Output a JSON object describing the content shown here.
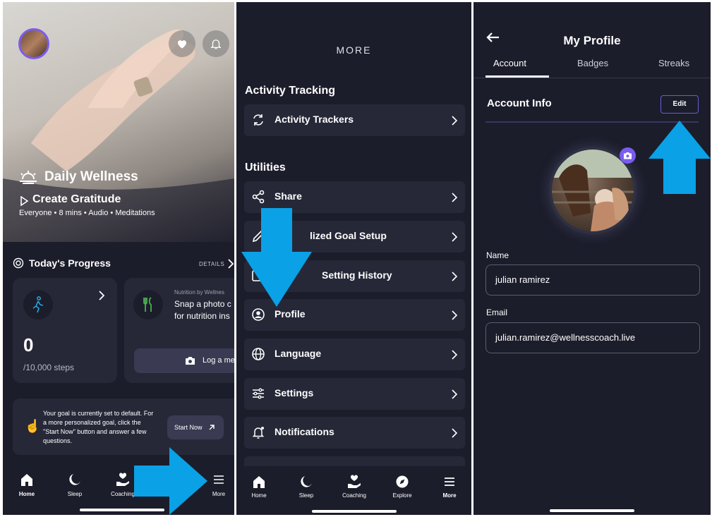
{
  "home": {
    "hero_title": "Daily Wellness",
    "hero_subtitle": "Create Gratitude",
    "hero_meta": [
      "Everyone",
      "8 mins",
      "Audio",
      "Meditations"
    ],
    "progress_title": "Today's Progress",
    "details_label": "DETAILS",
    "steps_value": "0",
    "steps_goal": "/10,000 steps",
    "nutrition_header": "Nutrition by Wellnes",
    "nutrition_line1": "Snap a photo c",
    "nutrition_line2": "for nutrition ins",
    "log_meal_label": "Log a me",
    "goal_text_line1": "Your goal is currently set to default. For",
    "goal_text_line2": "a more personalized goal, click the",
    "goal_text_line3": "\"Start Now\" button and answer a few",
    "goal_text_line4": "questions.",
    "start_now_label": "Start Now",
    "nav": [
      {
        "label": "Home",
        "icon": "home-icon"
      },
      {
        "label": "Sleep",
        "icon": "moon-icon"
      },
      {
        "label": "Coaching",
        "icon": "hand-heart-icon"
      },
      {
        "label": "More",
        "icon": "menu-icon"
      }
    ]
  },
  "more": {
    "title": "MORE",
    "section_activity": "Activity Tracking",
    "section_utilities": "Utilities",
    "items": [
      {
        "label": "Activity Trackers",
        "icon": "refresh-icon"
      },
      {
        "label": "Share",
        "icon": "share-icon"
      },
      {
        "label": "lized Goal Setup",
        "icon": "pencil-icon"
      },
      {
        "label": "Setting History",
        "icon": "history-icon"
      },
      {
        "label": "Profile",
        "icon": "profile-icon"
      },
      {
        "label": "Language",
        "icon": "globe-icon"
      },
      {
        "label": "Settings",
        "icon": "sliders-icon"
      },
      {
        "label": "Notifications",
        "icon": "bell-icon"
      }
    ],
    "nav": [
      {
        "label": "Home",
        "icon": "home-icon"
      },
      {
        "label": "Sleep",
        "icon": "moon-icon"
      },
      {
        "label": "Coaching",
        "icon": "hand-heart-icon"
      },
      {
        "label": "Explore",
        "icon": "compass-icon"
      },
      {
        "label": "More",
        "icon": "menu-icon"
      }
    ]
  },
  "profile": {
    "title": "My Profile",
    "tabs": [
      "Account",
      "Badges",
      "Streaks"
    ],
    "active_tab": "Account",
    "section_title": "Account Info",
    "edit_label": "Edit",
    "name_label": "Name",
    "name_value": "julian ramirez",
    "email_label": "Email",
    "email_value": "julian.ramirez@wellnesscoach.live"
  },
  "colors": {
    "background": "#1c1d2b",
    "card": "#262838",
    "accent_purple": "#7b5cf0",
    "arrow_blue": "#0aa1e6"
  }
}
